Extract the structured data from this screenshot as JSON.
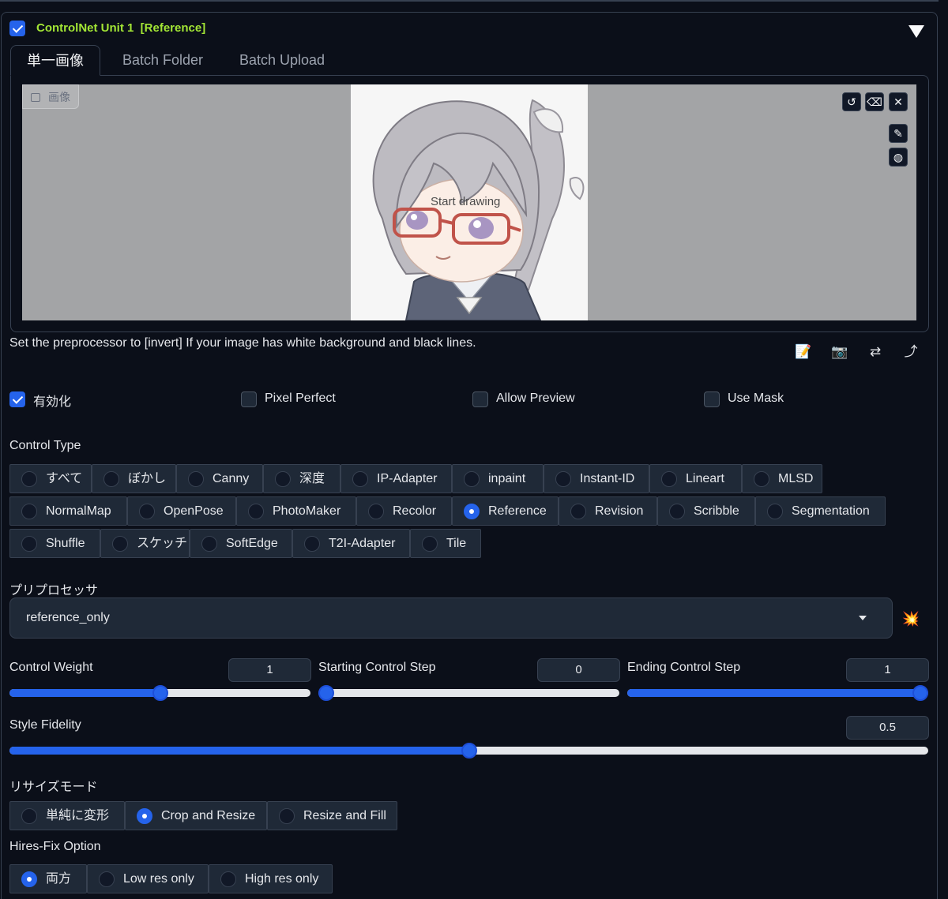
{
  "unit": {
    "enabled": true,
    "title": "ControlNet Unit 1  [Reference]"
  },
  "tabs": [
    "単一画像",
    "Batch Folder",
    "Batch Upload"
  ],
  "image_panel": {
    "label": "画像",
    "overlay_text": "Start drawing",
    "tool_icons": [
      "undo-icon",
      "eraser-icon",
      "close-icon",
      "brush-icon",
      "palette-icon"
    ]
  },
  "hint": "Set the preprocessor to [invert] If your image has white background and black lines.",
  "action_icons": [
    {
      "name": "notepad-icon",
      "glyph": "📝"
    },
    {
      "name": "camera-icon",
      "glyph": "📷"
    },
    {
      "name": "swap-icon",
      "glyph": "⇄"
    },
    {
      "name": "send-arrow-icon",
      "glyph": "⤴"
    }
  ],
  "options": [
    {
      "label": "有効化",
      "checked": true
    },
    {
      "label": "Pixel Perfect",
      "checked": false
    },
    {
      "label": "Allow Preview",
      "checked": false
    },
    {
      "label": "Use Mask",
      "checked": false
    }
  ],
  "control_type": {
    "label": "Control Type",
    "options": [
      "すべて",
      "ぼかし",
      "Canny",
      "深度",
      "IP-Adapter",
      "inpaint",
      "Instant-ID",
      "Lineart",
      "MLSD",
      "NormalMap",
      "OpenPose",
      "PhotoMaker",
      "Recolor",
      "Reference",
      "Revision",
      "Scribble",
      "Segmentation",
      "Shuffle",
      "スケッチ",
      "SoftEdge",
      "T2I-Adapter",
      "Tile"
    ],
    "selected": "Reference"
  },
  "preprocessor": {
    "label": "プリプロセッサ",
    "value": "reference_only",
    "run_icon": "💥"
  },
  "sliders": {
    "control_weight": {
      "label": "Control Weight",
      "value": "1",
      "min": 0,
      "max": 2,
      "num": 1
    },
    "starting_step": {
      "label": "Starting Control Step",
      "value": "0",
      "min": 0,
      "max": 1,
      "num": 0
    },
    "ending_step": {
      "label": "Ending Control Step",
      "value": "1",
      "min": 0,
      "max": 1,
      "num": 1
    },
    "style_fidelity": {
      "label": "Style Fidelity",
      "value": "0.5",
      "min": 0,
      "max": 1,
      "num": 0.5
    }
  },
  "resize_mode": {
    "label": "リサイズモード",
    "options": [
      "単純に変形",
      "Crop and Resize",
      "Resize and Fill"
    ],
    "selected": "Crop and Resize"
  },
  "hires_fix": {
    "label": "Hires-Fix Option",
    "options": [
      "両方",
      "Low res only",
      "High res only"
    ],
    "selected": "両方"
  },
  "colors": {
    "accent": "#2563eb",
    "title": "#a3e635",
    "background": "#0b0f19"
  }
}
